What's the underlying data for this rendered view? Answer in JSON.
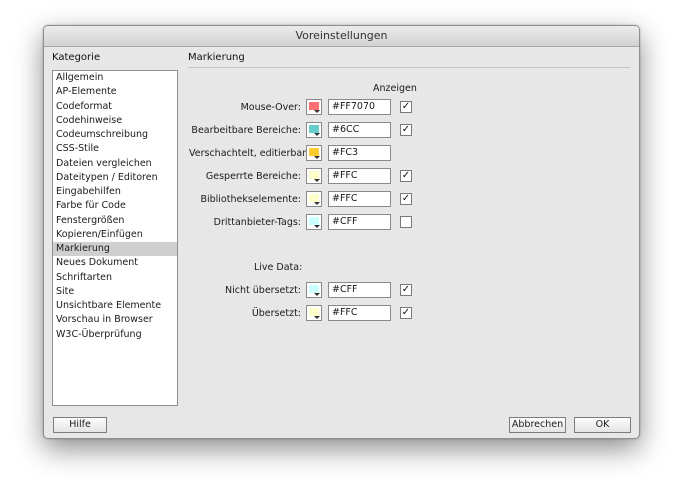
{
  "window": {
    "title": "Voreinstellungen"
  },
  "sidebar": {
    "heading": "Kategorie",
    "items": [
      "Allgemein",
      "AP-Elemente",
      "Codeformat",
      "Codehinweise",
      "Codeumschreibung",
      "CSS-Stile",
      "Dateien vergleichen",
      "Dateitypen / Editoren",
      "Eingabehilfen",
      "Farbe für Code",
      "Fenstergrößen",
      "Kopieren/Einfügen",
      "Markierung",
      "Neues Dokument",
      "Schriftarten",
      "Site",
      "Unsichtbare Elemente",
      "Vorschau in Browser",
      "W3C-Überprüfung"
    ],
    "selected_index": 12
  },
  "panel": {
    "title": "Markierung",
    "show_header": "Anzeigen",
    "rows": [
      {
        "label": "Mouse-Over:",
        "hex": "#FF7070",
        "swatch_color": "#FF7070",
        "checked": true,
        "has_check": true
      },
      {
        "label": "Bearbeitbare Bereiche:",
        "hex": "#6CC",
        "swatch_color": "#66CCCC",
        "checked": true,
        "has_check": true
      },
      {
        "label": "Verschachtelt, editierbar:",
        "hex": "#FC3",
        "swatch_color": "#FFCC33",
        "checked": false,
        "has_check": false
      },
      {
        "label": "Gesperrte Bereiche:",
        "hex": "#FFC",
        "swatch_color": "#FFFFCC",
        "checked": true,
        "has_check": true
      },
      {
        "label": "Bibliothekselemente:",
        "hex": "#FFC",
        "swatch_color": "#FFFFCC",
        "checked": true,
        "has_check": true
      },
      {
        "label": "Drittanbieter-Tags:",
        "hex": "#CFF",
        "swatch_color": "#CCFFFF",
        "checked": false,
        "has_check": true
      }
    ],
    "live_data_label": "Live Data:",
    "live_rows": [
      {
        "label": "Nicht übersetzt:",
        "hex": "#CFF",
        "swatch_color": "#CCFFFF",
        "checked": true,
        "has_check": true
      },
      {
        "label": "Übersetzt:",
        "hex": "#FFC",
        "swatch_color": "#FFFFCC",
        "checked": true,
        "has_check": true
      }
    ]
  },
  "buttons": {
    "help": "Hilfe",
    "cancel": "Abbrechen",
    "ok": "OK"
  }
}
